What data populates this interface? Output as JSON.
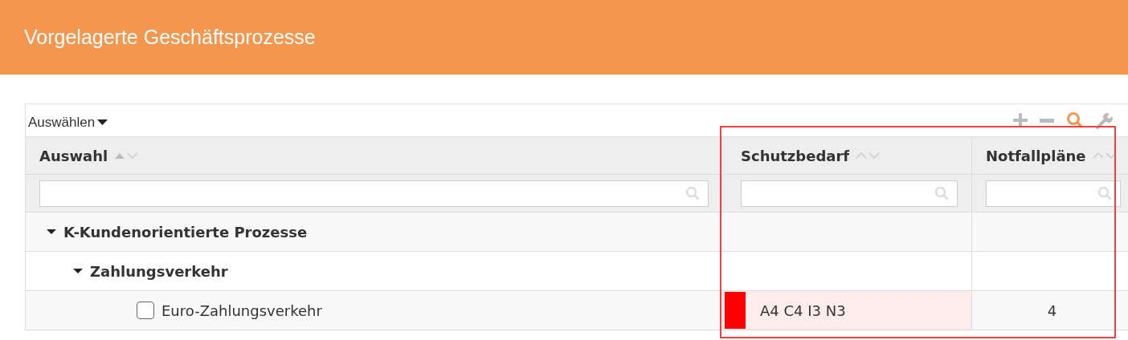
{
  "title": "Vorgelagerte Geschäftsprozesse",
  "toolbar": {
    "select_menu": "Auswählen",
    "search_active": true
  },
  "columns": [
    {
      "label": "Auswahl",
      "sorted": true
    },
    {
      "label": "Schutzbedarf",
      "sorted": false
    },
    {
      "label": "Notfallpläne",
      "sorted": false
    }
  ],
  "rows": [
    {
      "label": "K-Kundenorientierte Prozesse",
      "expanded": true,
      "children": [
        {
          "label": "Zahlungsverkehr",
          "expanded": true,
          "children": [
            {
              "label": "Euro-Zahlungsverkehr",
              "checked": false,
              "schutzbedarf": "A4 C4 I3 N3",
              "color": "#ff0000",
              "notfallplaene": "4"
            }
          ]
        }
      ]
    }
  ]
}
